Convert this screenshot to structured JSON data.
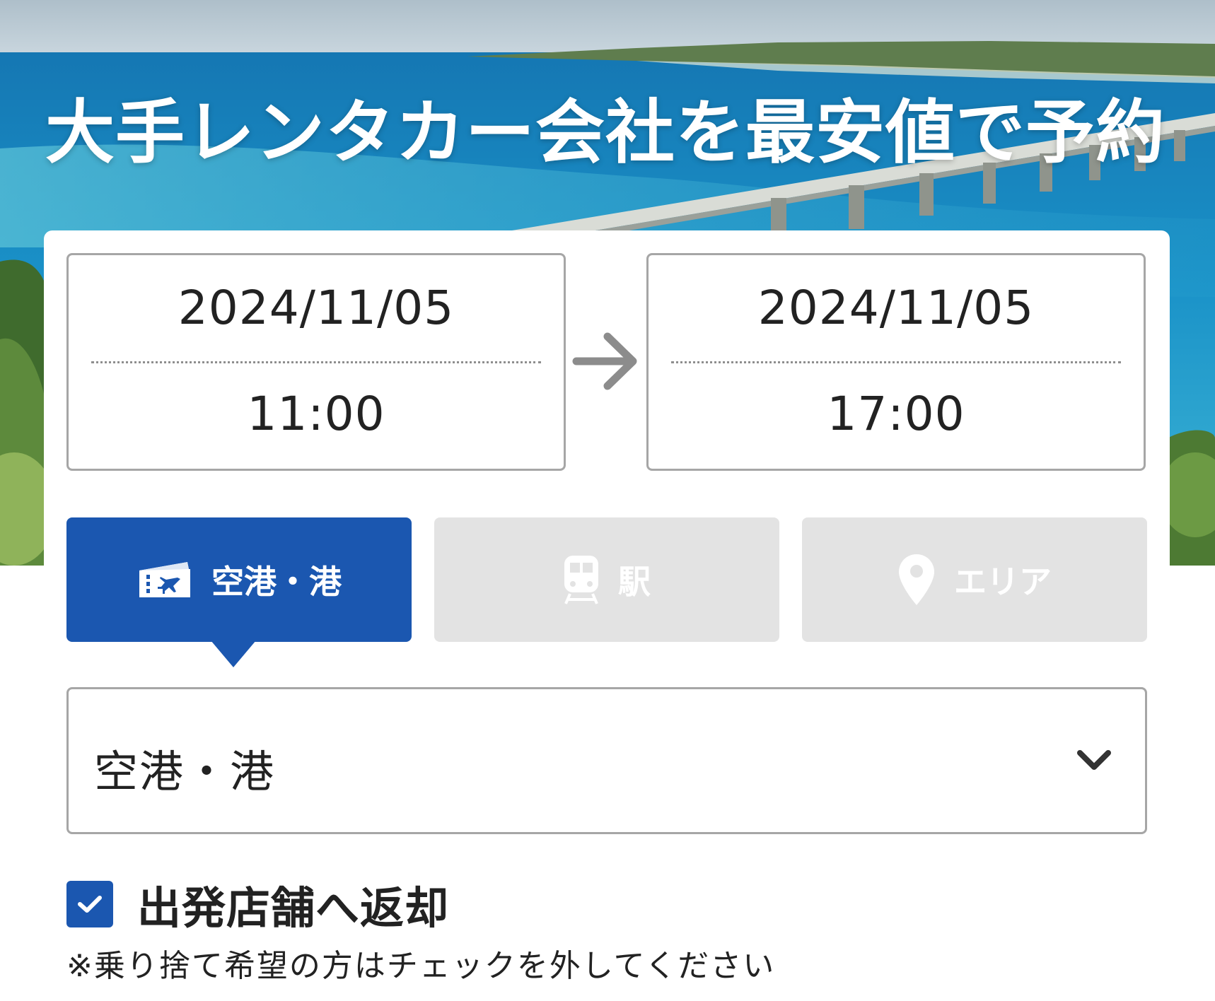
{
  "hero": {
    "title": "大手レンタカー会社を最安値で予約"
  },
  "pickup": {
    "date": "2024/11/05",
    "time": "11:00"
  },
  "return": {
    "date": "2024/11/05",
    "time": "17:00"
  },
  "tabs": [
    {
      "label": "空港・港",
      "icon": "airplane-ticket-icon",
      "active": true
    },
    {
      "label": "駅",
      "icon": "train-icon",
      "active": false
    },
    {
      "label": "エリア",
      "icon": "map-pin-icon",
      "active": false
    }
  ],
  "location_select": {
    "value": "空港・港"
  },
  "same_store_return": {
    "checked": true,
    "label": "出発店舗へ返却",
    "note": "※乗り捨て希望の方はチェックを外してください"
  },
  "colors": {
    "accent": "#1b57b0",
    "inactive_tab": "#e3e3e3",
    "border": "#a6a6a6"
  }
}
